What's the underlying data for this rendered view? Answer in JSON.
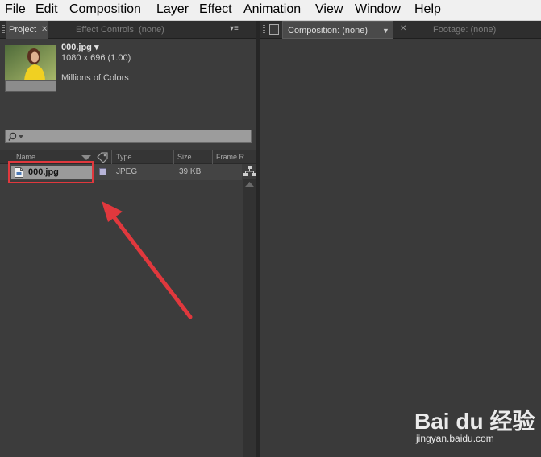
{
  "menu": [
    "File",
    "Edit",
    "Composition",
    "Layer",
    "Effect",
    "Animation",
    "View",
    "Window",
    "Help"
  ],
  "left_tabs": {
    "project": "Project",
    "effect_controls": "Effect Controls: (none)"
  },
  "right_tabs": {
    "composition": "Composition: (none)",
    "footage": "Footage: (none)"
  },
  "preview": {
    "filename": "000.jpg ▾",
    "dimensions": "1080 x 696 (1.00)",
    "colors": "Millions of Colors"
  },
  "columns": {
    "name": "Name",
    "type": "Type",
    "size": "Size",
    "frame_rate": "Frame R..."
  },
  "items": [
    {
      "name": "000.jpg",
      "type": "JPEG",
      "size": "39 KB",
      "label_color": "#b8b5d8"
    }
  ],
  "watermark": {
    "logo": "Bai du 经验",
    "url": "jingyan.baidu.com"
  },
  "colors": {
    "highlight": "#e0383d",
    "panel": "#3c3c3c",
    "menubar": "#f0f0f0"
  }
}
